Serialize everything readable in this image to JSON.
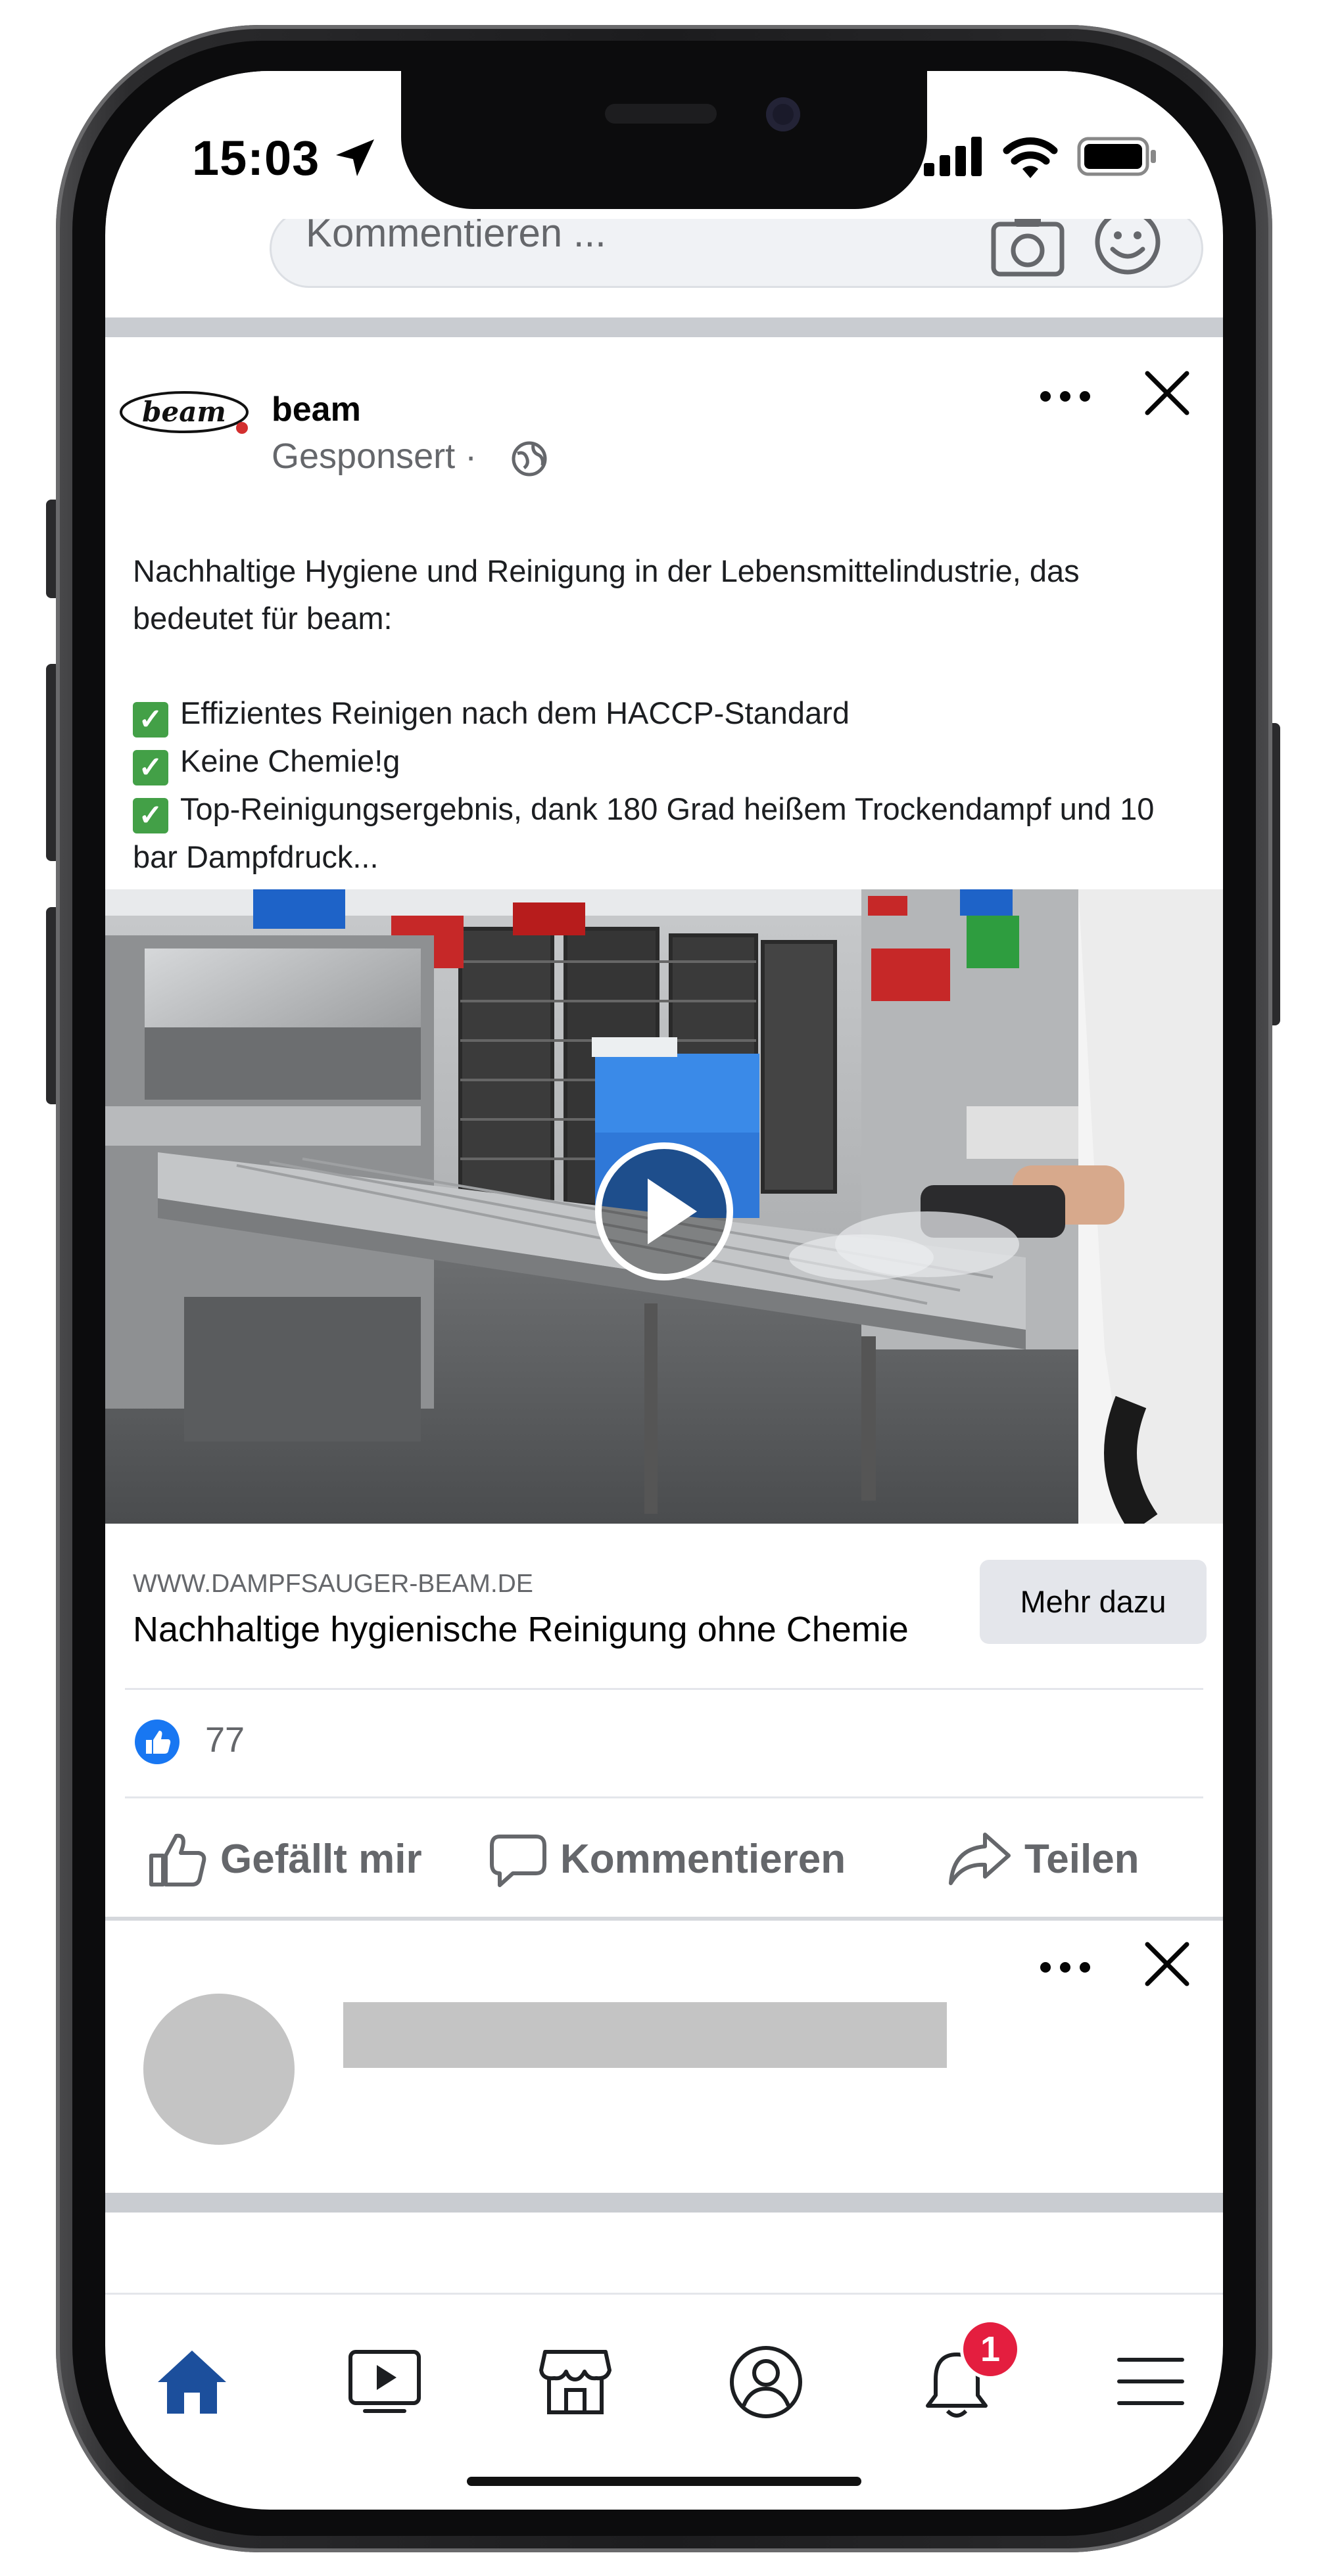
{
  "status_bar": {
    "time": "15:03"
  },
  "composer": {
    "placeholder": "Kommentieren ..."
  },
  "post": {
    "author": "beam",
    "logo_text": "beam",
    "sponsored_label": "Gesponsert ·",
    "text_intro_1": "Nachhaltige Hygiene und Reinigung in der Lebensmittelindustrie, das",
    "text_intro_2": "bedeutet für beam:",
    "bullets": [
      "Effizientes Reinigen nach dem HACCP-Standard",
      "Keine Chemie!g",
      "Top-Reinigungsergebnis, dank 180 Grad heißem Trockendampf und 10"
    ],
    "text_wrap": "bar Dampfdruck...",
    "link_url": "WWW.DAMPFSAUGER-BEAM.DE",
    "link_title": "Nachhaltige hygienische Reinigung ohne Chemie",
    "cta_label": "Mehr dazu",
    "like_count": "77",
    "actions": {
      "like": "Gefällt mir",
      "comment": "Kommentieren",
      "share": "Teilen"
    }
  },
  "bottom_nav": {
    "items": [
      "home-icon",
      "watch-icon",
      "marketplace-icon",
      "profile-icon",
      "notifications-icon",
      "menu-icon"
    ],
    "notification_badge": "1"
  },
  "colors": {
    "facebook_blue": "#1877f2",
    "nav_active": "#1c4f9c",
    "badge_red": "#e41e3f",
    "check_green": "#43a047"
  }
}
